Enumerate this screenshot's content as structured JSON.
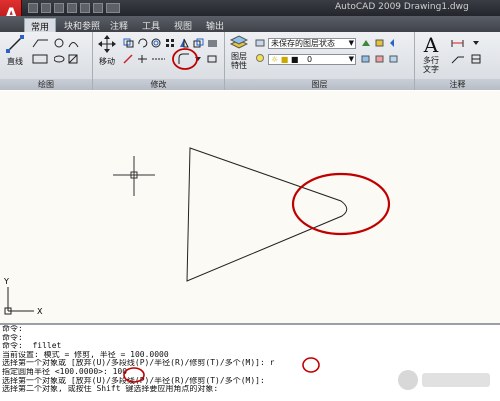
{
  "titlebar": {
    "title": "AutoCAD 2009 Drawing1.dwg",
    "logo_letter": "A"
  },
  "tabs": [
    {
      "label": "常用",
      "active": true
    },
    {
      "label": "块和参照",
      "active": false
    },
    {
      "label": "注释",
      "active": false
    },
    {
      "label": "工具",
      "active": false
    },
    {
      "label": "视图",
      "active": false
    },
    {
      "label": "输出",
      "active": false
    }
  ],
  "ribbon": {
    "draw": {
      "title": "绘图",
      "line_label": "直线"
    },
    "modify": {
      "title": "修改",
      "move_label": "移动"
    },
    "layers": {
      "title": "图层",
      "layer_props_label": "图层\n特性",
      "layer_state": "未保存的图层状态",
      "current_layer": "0"
    },
    "annotation": {
      "title": "注释",
      "multiline_text_label": "多行\n文字",
      "text_icon": "A"
    }
  },
  "canvas": {
    "ucs_y": "Y",
    "ucs_x": "X",
    "highlight_color": "#c00000"
  },
  "command_lines": [
    "命令:",
    "命令:",
    "命令:  fillet",
    "当前设置: 模式 = 修剪, 半径 = 100.0000",
    "选择第一个对象或 [放弃(U)/多段线(P)/半径(R)/修剪(T)/多个(M)]: r",
    "指定圆角半径 <100.0000>: 100",
    "选择第一个对象或 [放弃(U)/多段线(P)/半径(R)/修剪(T)/多个(M)]:",
    "选择第二个对象, 或按住 Shift 键选择要应用角点的对象:"
  ]
}
